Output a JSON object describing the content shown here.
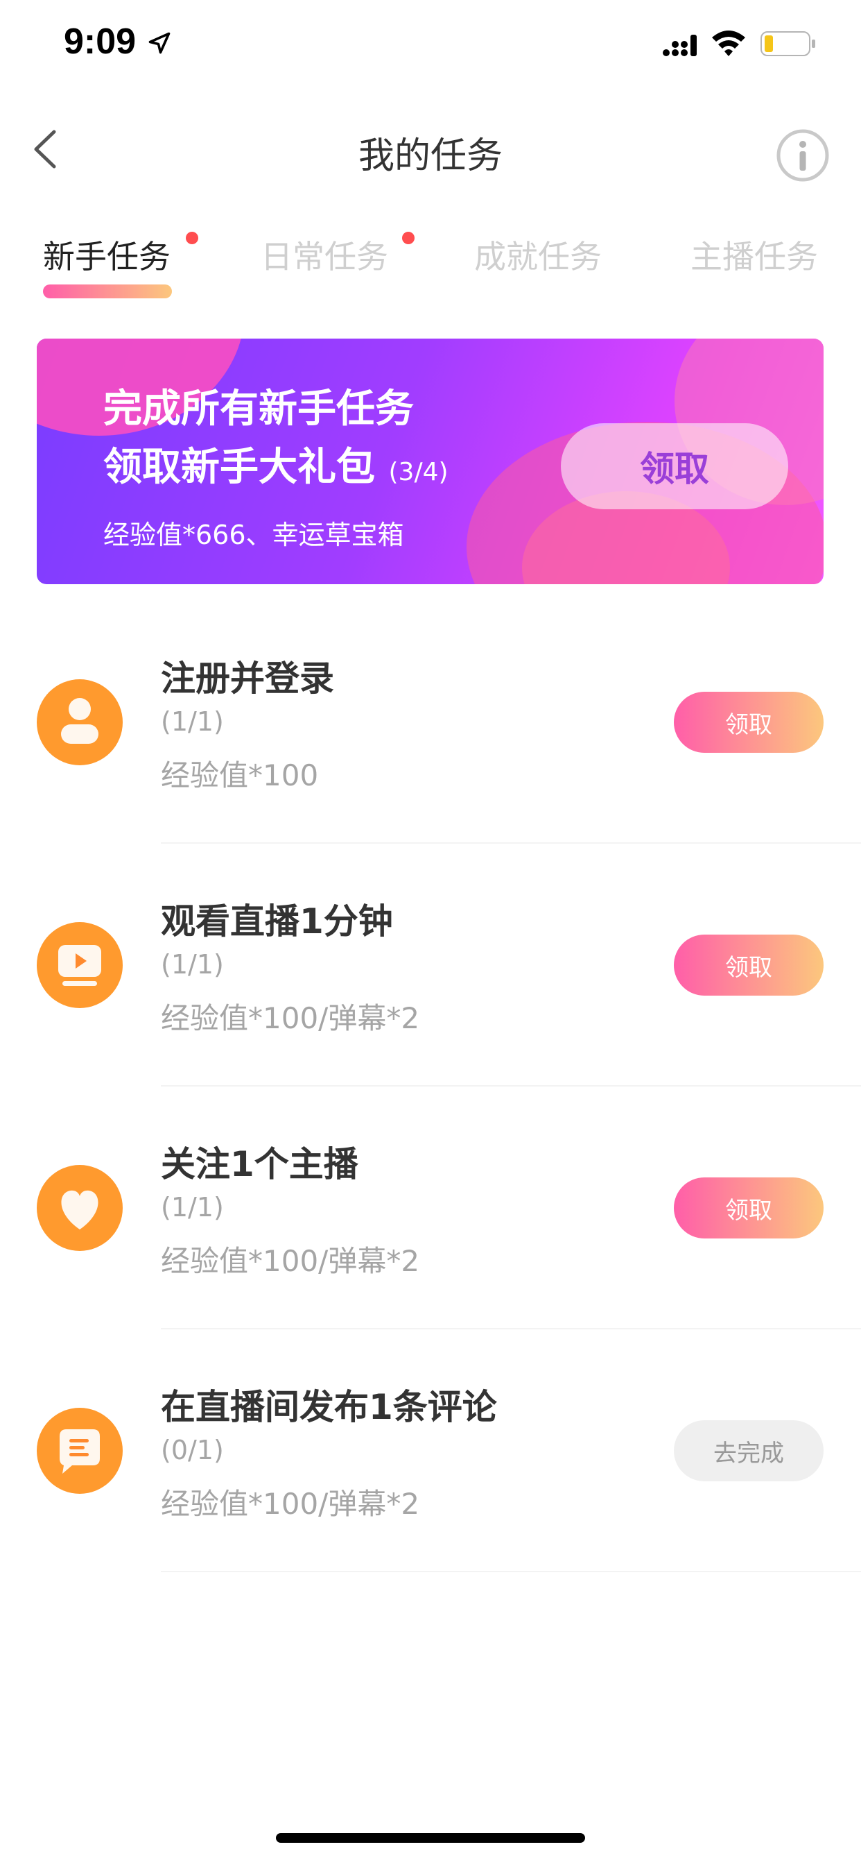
{
  "status_bar": {
    "time": "9:09"
  },
  "header": {
    "title": "我的任务"
  },
  "tabs": [
    {
      "label": "新手任务",
      "active": true,
      "has_dot": true
    },
    {
      "label": "日常任务",
      "active": false,
      "has_dot": true
    },
    {
      "label": "成就任务",
      "active": false,
      "has_dot": false
    },
    {
      "label": "主播任务",
      "active": false,
      "has_dot": false
    }
  ],
  "banner": {
    "line1": "完成所有新手任务",
    "line2": "领取新手大礼包",
    "progress": "(3/4)",
    "subtitle": "经验值*666、幸运草宝箱",
    "button_label": "领取"
  },
  "tasks": [
    {
      "title": "注册并登录",
      "progress": "(1/1)",
      "reward": "经验值*100",
      "button_label": "领取",
      "button_state": "claim",
      "icon": "user-icon"
    },
    {
      "title": "观看直播1分钟",
      "progress": "(1/1)",
      "reward": "经验值*100/弹幕*2",
      "button_label": "领取",
      "button_state": "claim",
      "icon": "tv-play-icon"
    },
    {
      "title": "关注1个主播",
      "progress": "(1/1)",
      "reward": "经验值*100/弹幕*2",
      "button_label": "领取",
      "button_state": "claim",
      "icon": "heart-icon"
    },
    {
      "title": "在直播间发布1条评论",
      "progress": "(0/1)",
      "reward": "经验值*100/弹幕*2",
      "button_label": "去完成",
      "button_state": "todo",
      "icon": "comment-icon"
    }
  ],
  "colors": {
    "accent_gradient_start": "#ff5ea9",
    "accent_gradient_end": "#fcc77d",
    "banner_start": "#7a3dff",
    "banner_end": "#f05aff",
    "icon_orange": "#ff9a2e",
    "tab_dot": "#ff4d4f"
  }
}
